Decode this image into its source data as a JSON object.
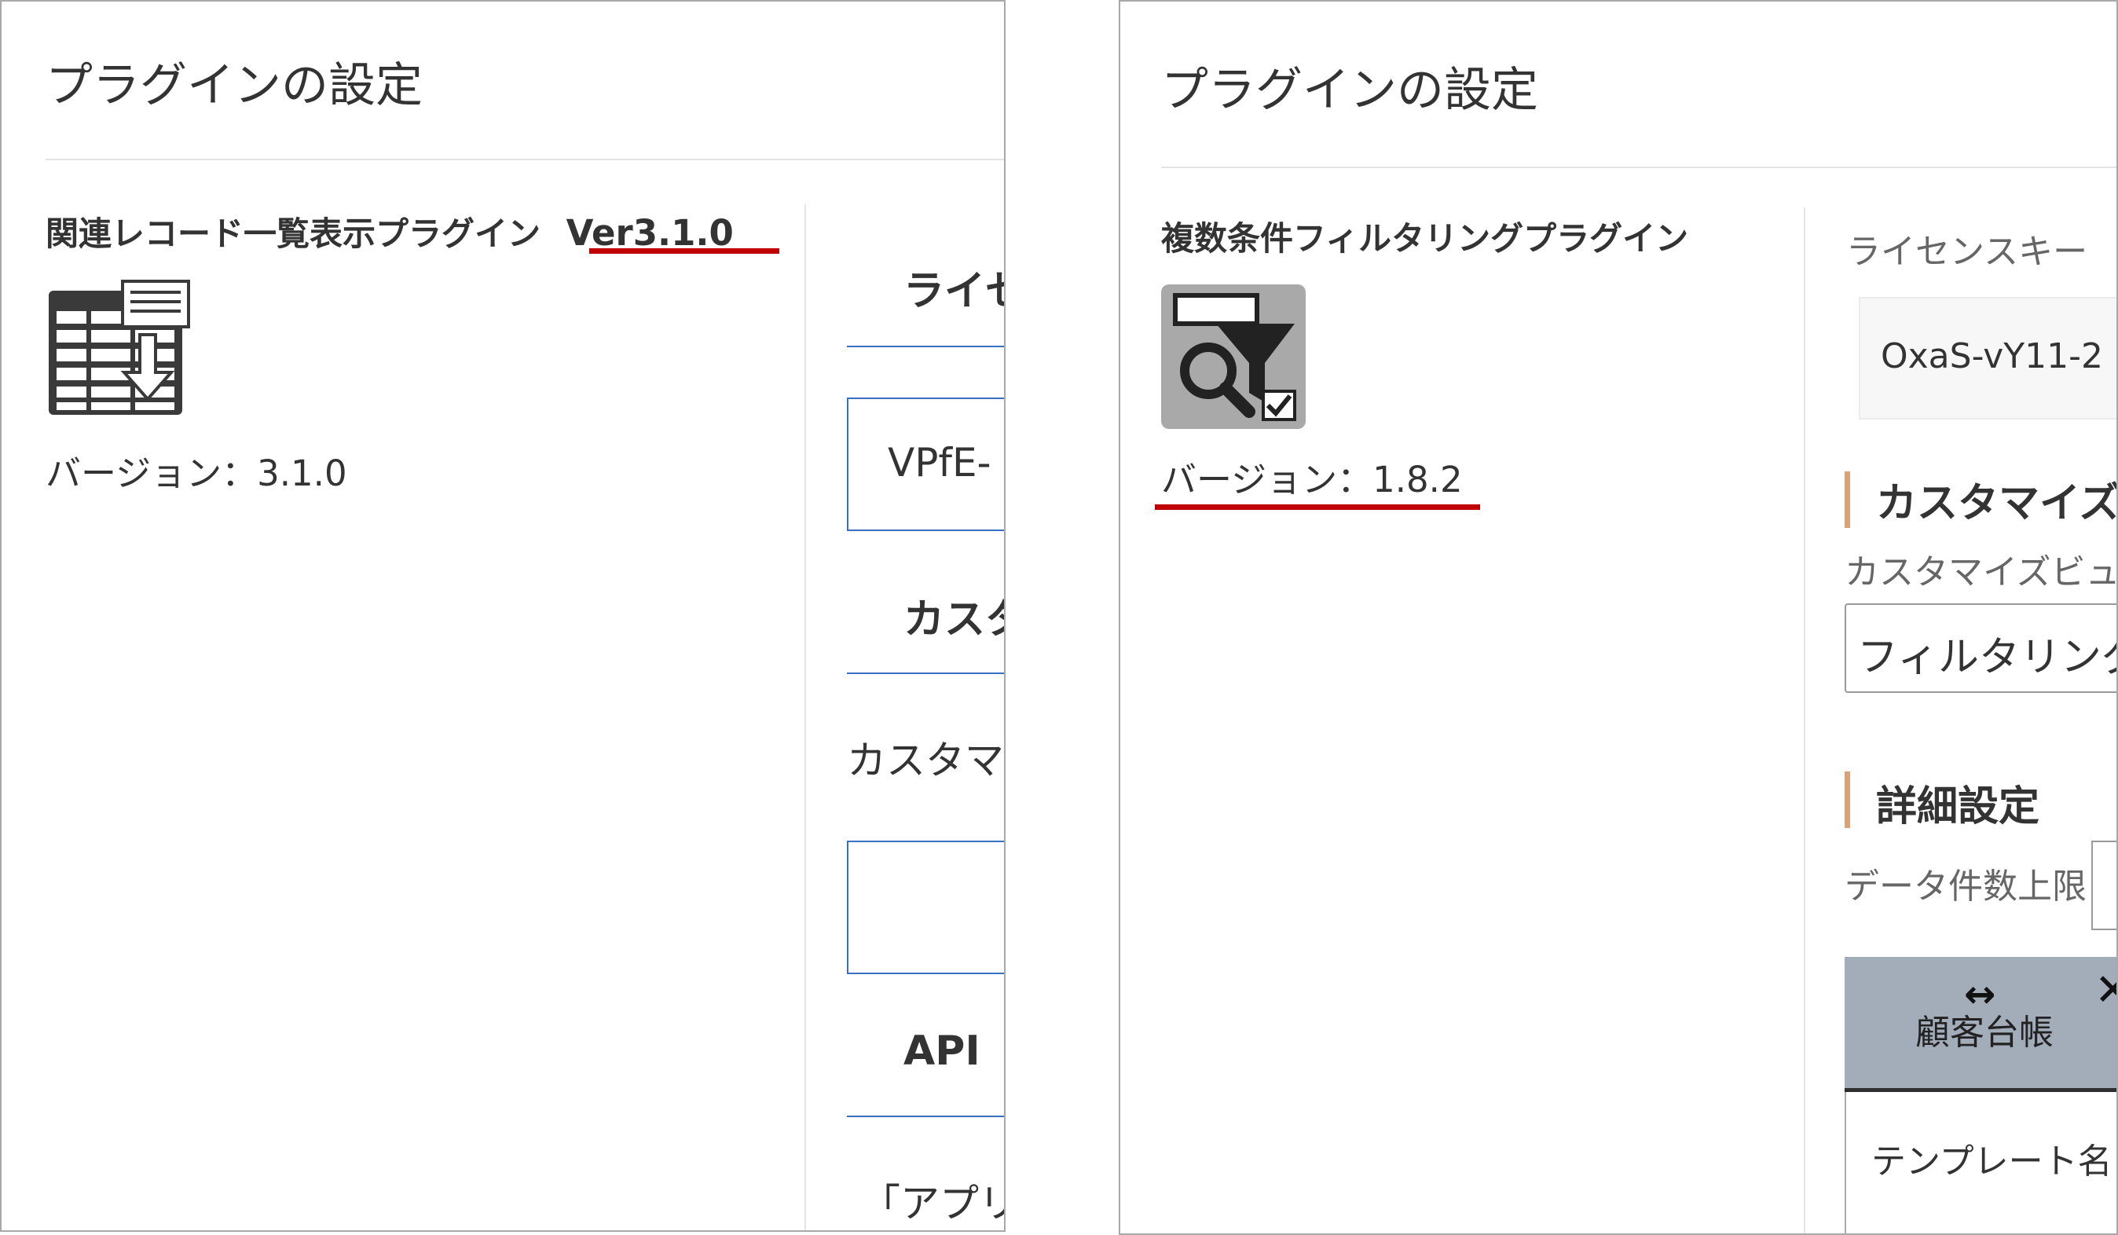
{
  "left": {
    "title": "プラグインの設定",
    "plugin_name": "関連レコード一覧表示プラグイン",
    "plugin_version_tag": "Ver3.1.0",
    "icon": "table-download-icon",
    "version_label": "バージョン：3.1.0",
    "sections": [
      {
        "heading": "ライセ"
      },
      {
        "heading": "カスタ"
      },
      {
        "heading": "API"
      }
    ],
    "license_value": "VPfE-",
    "customize_text": "カスタマ",
    "quote_text": "「アプリ"
  },
  "right": {
    "title": "プラグインの設定",
    "plugin_name": "複数条件フィルタリングプラグイン",
    "icon": "filter-search-icon",
    "version_label": "バージョン：1.8.2",
    "license_label": "ライセンスキー",
    "license_value": "OxaS-vY11-2",
    "customize_heading": "カスタマイズ",
    "customize_label": "カスタマイズビュ",
    "customize_select_value": "フィルタリング",
    "detail_heading": "詳細設定",
    "data_limit_label": "データ件数上限",
    "tab_label": "顧客台帳",
    "tab_icons": [
      "resize-horizontal-icon",
      "close-icon"
    ],
    "template_label": "テンプレート名"
  },
  "colors": {
    "underline_red": "#c00000",
    "section_blue": "#3b6fc4",
    "accent_orange": "#d9a377",
    "tab_gray": "#a3acb9"
  }
}
